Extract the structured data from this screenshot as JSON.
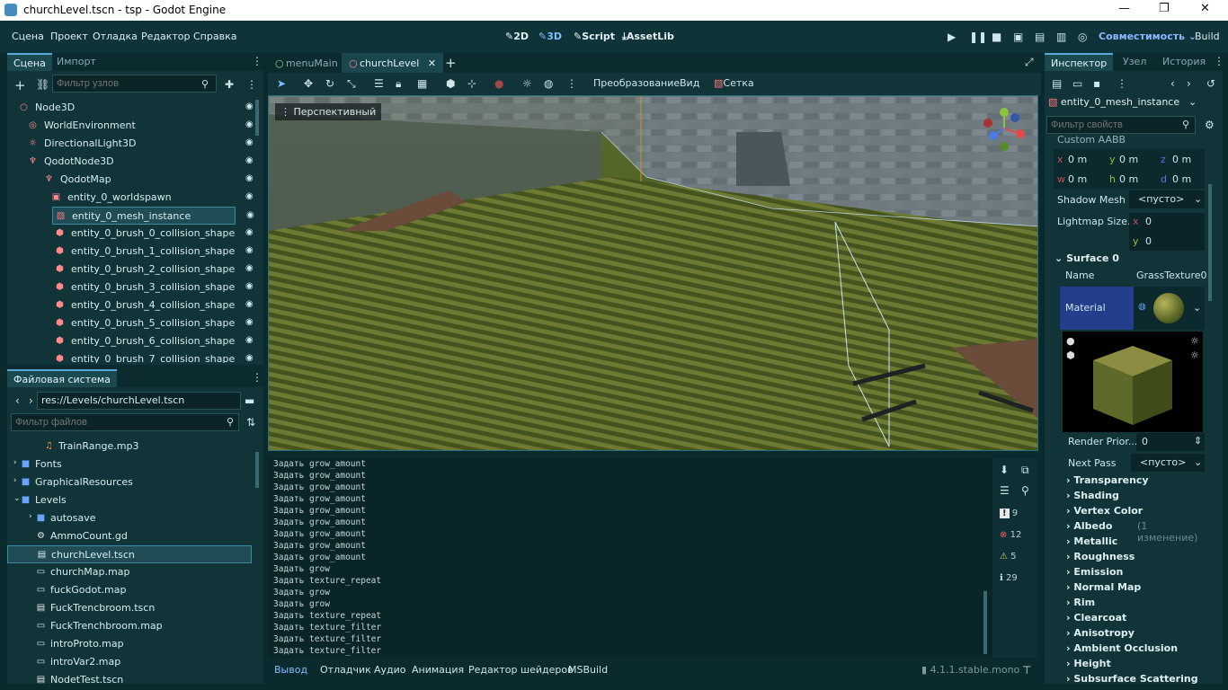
{
  "window": {
    "title": "churchLevel.tscn - tsp - Godot Engine"
  },
  "menu": {
    "items": [
      "Сцена",
      "Проект",
      "Отладка",
      "Редактор",
      "Справка"
    ]
  },
  "modes": {
    "m2d": "2D",
    "m3d": "3D",
    "script": "Script",
    "assetlib": "AssetLib"
  },
  "right_top": {
    "renderer": "Совместимость",
    "build": "Build"
  },
  "scene_panel": {
    "tabs": [
      "Сцена",
      "Импорт"
    ],
    "filter_placeholder": "Фильтр узлов",
    "nodes": [
      {
        "label": "Node3D",
        "depth": 0
      },
      {
        "label": "WorldEnvironment",
        "depth": 1
      },
      {
        "label": "DirectionalLight3D",
        "depth": 1
      },
      {
        "label": "QodotNode3D",
        "depth": 1
      },
      {
        "label": "QodotMap",
        "depth": 2
      },
      {
        "label": "entity_0_worldspawn",
        "depth": 3
      },
      {
        "label": "entity_0_mesh_instance",
        "depth": 4
      },
      {
        "label": "entity_0_brush_0_collision_shape",
        "depth": 4
      },
      {
        "label": "entity_0_brush_1_collision_shape",
        "depth": 4
      },
      {
        "label": "entity_0_brush_2_collision_shape",
        "depth": 4
      },
      {
        "label": "entity_0_brush_3_collision_shape",
        "depth": 4
      },
      {
        "label": "entity_0_brush_4_collision_shape",
        "depth": 4
      },
      {
        "label": "entity_0_brush_5_collision_shape",
        "depth": 4
      },
      {
        "label": "entity_0_brush_6_collision_shape",
        "depth": 4
      },
      {
        "label": "entity_0_brush_7_collision_shape",
        "depth": 4
      }
    ]
  },
  "fs_panel": {
    "title": "Файловая система",
    "path": "res://Levels/churchLevel.tscn",
    "filter_placeholder": "Фильтр файлов",
    "items": [
      {
        "label": "TrainRange.mp3",
        "depth": 2,
        "kind": "audio"
      },
      {
        "label": "Fonts",
        "depth": 1,
        "kind": "folder"
      },
      {
        "label": "GraphicalResources",
        "depth": 1,
        "kind": "folder"
      },
      {
        "label": "Levels",
        "depth": 1,
        "kind": "folder-open"
      },
      {
        "label": "autosave",
        "depth": 2,
        "kind": "folder"
      },
      {
        "label": "AmmoCount.gd",
        "depth": 2,
        "kind": "gear"
      },
      {
        "label": "churchLevel.tscn",
        "depth": 2,
        "kind": "scene"
      },
      {
        "label": "churchMap.map",
        "depth": 2,
        "kind": "file"
      },
      {
        "label": "fuckGodot.map",
        "depth": 2,
        "kind": "file"
      },
      {
        "label": "FuckTrencbroom.tscn",
        "depth": 2,
        "kind": "scene"
      },
      {
        "label": "FuckTrenchbroom.map",
        "depth": 2,
        "kind": "file"
      },
      {
        "label": "introProto.map",
        "depth": 2,
        "kind": "file"
      },
      {
        "label": "introVar2.map",
        "depth": 2,
        "kind": "file"
      },
      {
        "label": "NodetTest.tscn",
        "depth": 2,
        "kind": "scene"
      }
    ]
  },
  "editor_tabs": [
    "menuMain",
    "churchLevel"
  ],
  "toolbar": {
    "transform": "Преобразование",
    "view": "Вид",
    "grid": "Сетка"
  },
  "viewport": {
    "perspective": "Перспективный"
  },
  "log": {
    "lines": [
      "Задать grow_amount",
      "Задать grow_amount",
      "Задать grow_amount",
      "Задать grow_amount",
      "Задать grow_amount",
      "Задать grow_amount",
      "Задать grow_amount",
      "Задать grow_amount",
      "Задать grow_amount",
      "Задать grow",
      "Задать texture_repeat",
      "Задать grow",
      "Задать grow",
      "Задать texture_repeat",
      "Задать texture_filter",
      "Задать texture_filter",
      "Задать texture_filter"
    ],
    "counts": {
      "messages": "9",
      "errors": "12",
      "warnings": "5",
      "info": "29"
    }
  },
  "bottom_tabs": [
    "Вывод",
    "Отладчик",
    "Аудио",
    "Анимация",
    "Редактор шейдеров",
    "MSBuild"
  ],
  "version": "4.1.1.stable.mono",
  "inspector": {
    "tabs": [
      "Инспектор",
      "Узел",
      "История"
    ],
    "node": "entity_0_mesh_instance",
    "filter_placeholder": "Фильтр свойств",
    "custom_aabb": "Custom AABB",
    "aabb": {
      "x": "0 m",
      "y": "0 m",
      "z": "0 m",
      "w": "0 m",
      "h": "0 m",
      "d": "0 m"
    },
    "shadow_mesh": "Shadow Mesh",
    "empty": "<пусто>",
    "lightmap": "Lightmap Size...",
    "lightmap_x": "0",
    "lightmap_y": "0",
    "surface": "Surface 0",
    "name_label": "Name",
    "name_value": "GrassTexture0",
    "material": "Material",
    "render_prior": "Render Prior...",
    "render_prior_value": "0",
    "next_pass": "Next Pass",
    "sections": [
      "Transparency",
      "Shading",
      "Vertex Color",
      "Albedo",
      "Metallic",
      "Roughness",
      "Emission",
      "Normal Map",
      "Rim",
      "Clearcoat",
      "Anisotropy",
      "Ambient Occlusion",
      "Height",
      "Subsurface Scattering"
    ],
    "albedo_changes": "(1 изменение)"
  }
}
